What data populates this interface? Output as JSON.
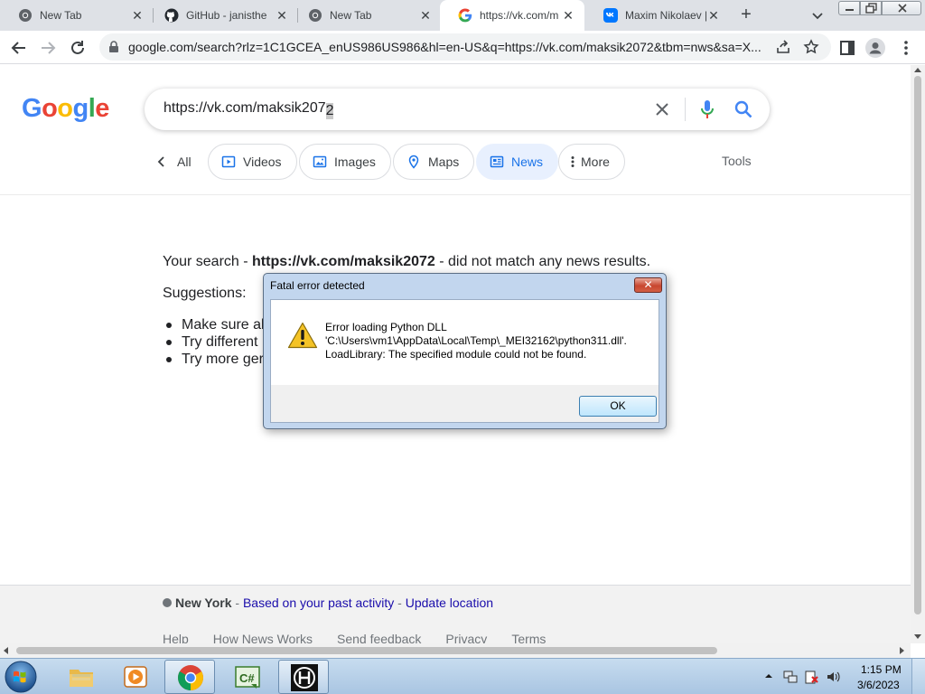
{
  "browser": {
    "tabs": [
      {
        "title": "New Tab",
        "favicon": "chrome-icon",
        "active": false
      },
      {
        "title": "GitHub - janisthe",
        "favicon": "github-icon",
        "active": false
      },
      {
        "title": "New Tab",
        "favicon": "chrome-icon",
        "active": false
      },
      {
        "title": "https://vk.com/m",
        "favicon": "google-icon",
        "active": true
      },
      {
        "title": "Maxim Nikolaev |",
        "favicon": "vk-icon",
        "active": false
      }
    ],
    "url": "google.com/search?rlz=1C1GCEA_enUS986US986&hl=en-US&q=https://vk.com/maksik2072&tbm=nws&sa=X..."
  },
  "google": {
    "logo_letters": [
      "G",
      "o",
      "o",
      "g",
      "l",
      "e"
    ],
    "query": "https://vk.com/maksik207",
    "query_last_char": "2",
    "filters": {
      "all": "All",
      "videos": "Videos",
      "images": "Images",
      "maps": "Maps",
      "news": "News",
      "more": "More",
      "tools": "Tools"
    },
    "no_match_prefix": "Your search - ",
    "no_match_query": "https://vk.com/maksik2072",
    "no_match_suffix": " - did not match any news results.",
    "suggestions_head": "Suggestions:",
    "suggestions": [
      "Make sure al",
      "Try different",
      "Try more ger"
    ],
    "footer": {
      "city": "New York",
      "sep1": " - ",
      "based_on": "Based on your past activity",
      "sep2": " - ",
      "update": "Update location",
      "links": [
        "Help",
        "How News Works",
        "Send feedback",
        "Privacy",
        "Terms"
      ]
    }
  },
  "dialog": {
    "title": "Fatal error detected",
    "close": "✕",
    "line1": "Error loading Python DLL",
    "line2": "'C:\\Users\\vm1\\AppData\\Local\\Temp\\_MEI32162\\python311.dll'.",
    "line3": "LoadLibrary: The specified module could not be found.",
    "ok": "OK"
  },
  "taskbar": {
    "time": "1:15 PM",
    "date": "3/6/2023",
    "apps": [
      "explorer-icon",
      "media-player-icon",
      "chrome-icon",
      "csharp-icon",
      "app-icon"
    ]
  },
  "colors": {
    "google_blue": "#4285f4",
    "google_red": "#ea4335",
    "google_yellow": "#fbbc05",
    "google_green": "#34a853",
    "active_chip_bg": "#e8f0fe",
    "active_chip_text": "#1a73e8",
    "link": "#1a0dab"
  }
}
